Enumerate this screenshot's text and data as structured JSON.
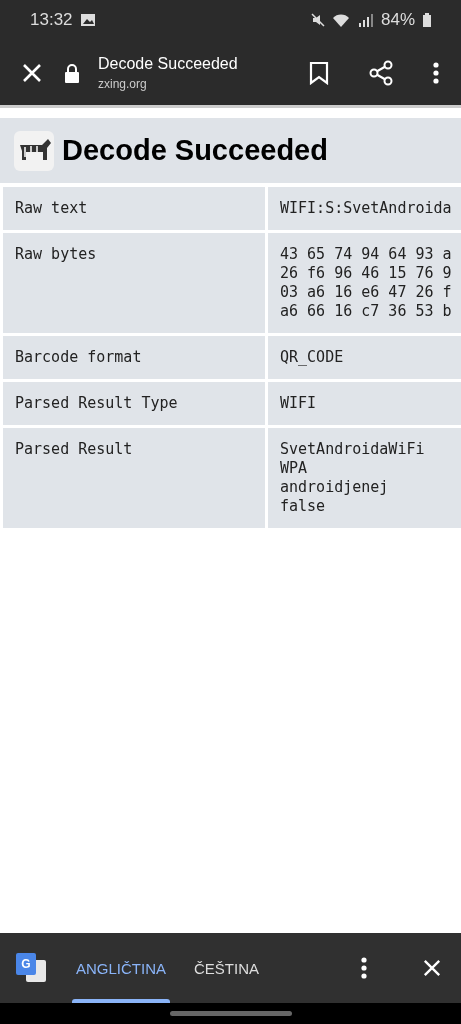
{
  "status_bar": {
    "time": "13:32",
    "battery": "84%"
  },
  "toolbar": {
    "title": "Decode Succeeded",
    "url": "zxing.org"
  },
  "page": {
    "heading": "Decode Succeeded",
    "rows": [
      {
        "label": "Raw text",
        "lines": [
          "WIFI:S:SvetAndroida"
        ]
      },
      {
        "label": "Raw bytes",
        "lines": [
          "43 65 74 94 64 93 a",
          "26 f6 96 46 15 76 9",
          "03 a6 16 e6 47 26 f",
          "a6 66 16 c7 36 53 b"
        ]
      },
      {
        "label": "Barcode format",
        "lines": [
          "QR_CODE"
        ]
      },
      {
        "label": "Parsed Result Type",
        "lines": [
          "WIFI"
        ]
      },
      {
        "label": "Parsed Result",
        "lines": [
          "SvetAndroidaWiFi",
          "WPA",
          "androidjenej",
          "false"
        ]
      }
    ]
  },
  "translate_bar": {
    "logo_letter": "G",
    "languages": [
      {
        "label": "ANGLIČTINA",
        "selected": true
      },
      {
        "label": "ČEŠTINA",
        "selected": false
      }
    ]
  }
}
